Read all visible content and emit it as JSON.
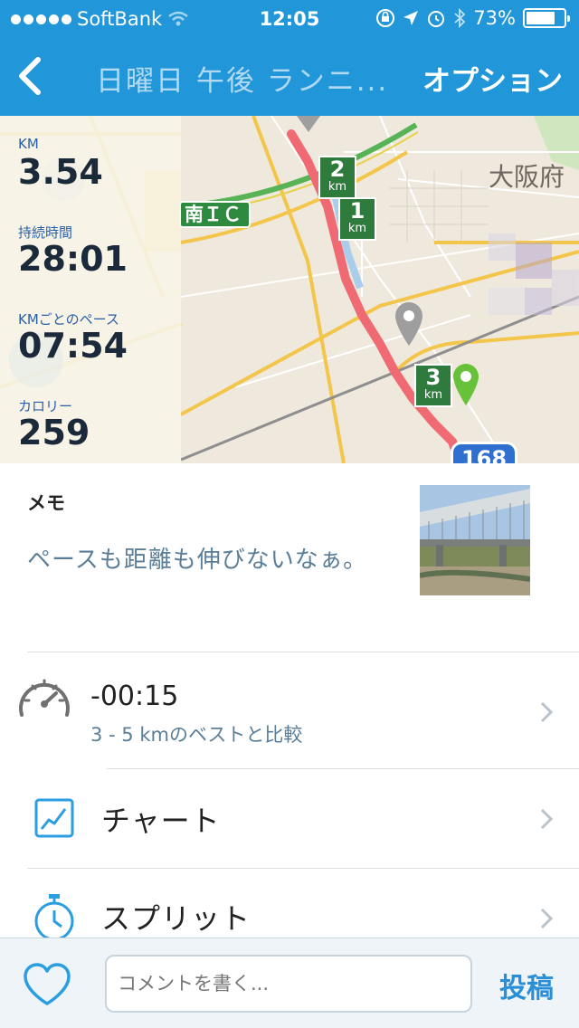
{
  "status_bar": {
    "carrier": "SoftBank",
    "time": "12:05",
    "battery": "73%",
    "battery_level": 0.73
  },
  "nav": {
    "title": "日曜日 午後 ランニ...",
    "option_label": "オプション"
  },
  "stats": [
    {
      "label": "KM",
      "value": "3.54"
    },
    {
      "label": "持続時間",
      "value": "28:01"
    },
    {
      "label": "KMごとのペース",
      "value": "07:54"
    },
    {
      "label": "カロリー",
      "value": "259"
    }
  ],
  "map": {
    "interchange_label": "南ＩＣ",
    "prefecture_label": "大阪府",
    "route_number": "168",
    "markers": [
      {
        "num": "2",
        "unit": "km"
      },
      {
        "num": "1",
        "unit": "km"
      },
      {
        "num": "3",
        "unit": "km"
      }
    ],
    "route_color": "#f06a74"
  },
  "memo": {
    "title": "メモ",
    "text": "ペースも距離も伸びないなぁ。"
  },
  "compare": {
    "value": "-00:15",
    "subtitle": "3 - 5 kmのベストと比較"
  },
  "rows": {
    "chart_label": "チャート",
    "splits_label": "スプリット"
  },
  "bottom": {
    "comment_placeholder": "コメントを書く...",
    "post_label": "投稿"
  },
  "colors": {
    "brand_blue": "#2196d9",
    "accent_blue": "#2a8fd6",
    "marker_green": "#2f7a3d"
  }
}
